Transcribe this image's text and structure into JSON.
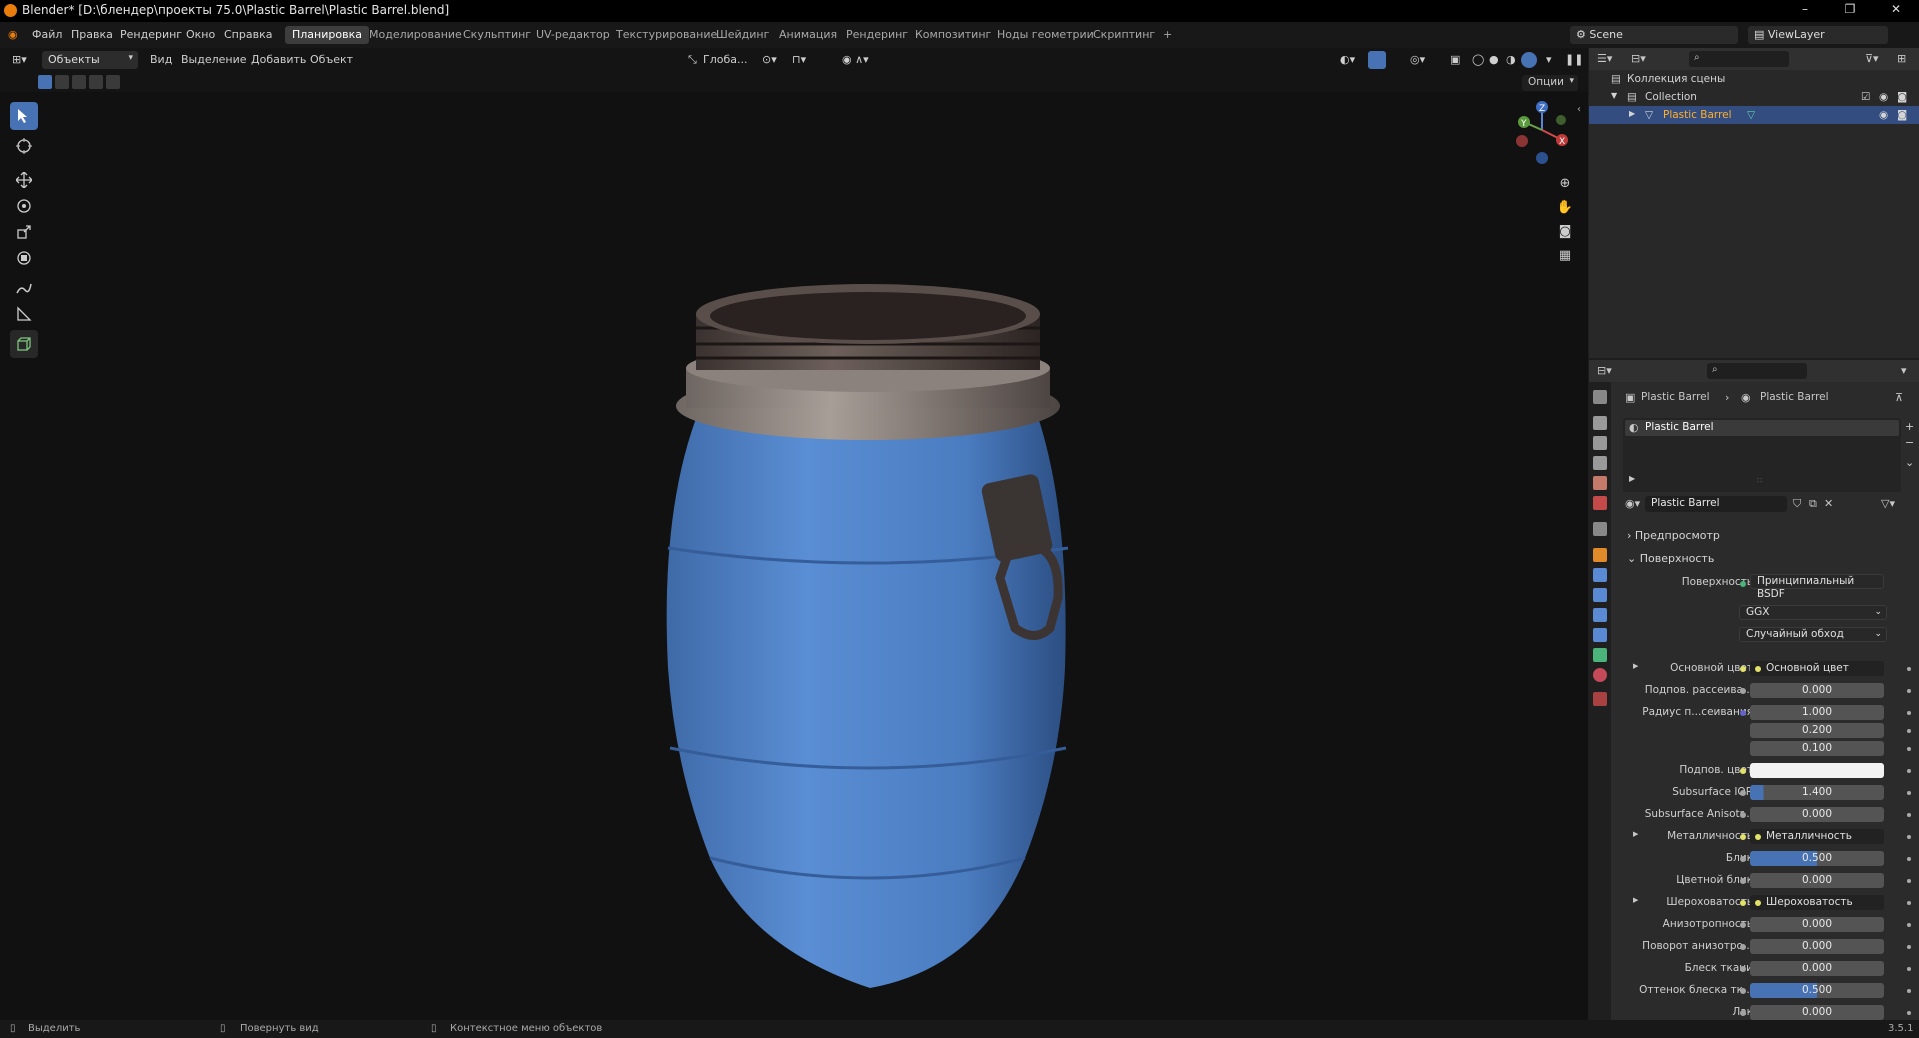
{
  "window": {
    "title": "Blender* [D:\\блендер\\проекты 75.0\\Plastic Barrel\\Plastic Barrel.blend]"
  },
  "menu": {
    "items": [
      "Файл",
      "Правка",
      "Рендеринг",
      "Окно",
      "Справка"
    ]
  },
  "workspaces": {
    "items": [
      "Планировка",
      "Моделирование",
      "Скульптинг",
      "UV-редактор",
      "Текстурирование",
      "Шейдинг",
      "Анимация",
      "Рендеринг",
      "Композитинг",
      "Ноды геометрии",
      "Скриптинг",
      "+"
    ],
    "active": "Планировка"
  },
  "scene": {
    "name": "Scene",
    "view_layer": "ViewLayer"
  },
  "viewport": {
    "mode": "Объекты",
    "menus": [
      "Вид",
      "Выделение",
      "Добавить",
      "Объект"
    ],
    "transform_orientation": "Глоба...",
    "options": "Опции",
    "gizmo": {
      "x": "X",
      "y": "Y",
      "z": "Z"
    }
  },
  "outliner": {
    "root": "Коллекция сцены",
    "collection": "Collection",
    "object": "Plastic Barrel"
  },
  "properties": {
    "breadcrumb": [
      "Plastic Barrel",
      "Plastic Barrel"
    ],
    "slot": "Plastic Barrel",
    "material_name": "Plastic Barrel",
    "sections": {
      "preview": "Предпросмотр",
      "surface": "Поверхность"
    },
    "surface_label": "Поверхность",
    "surface_value": "Принципиальный BSDF",
    "distribution": "GGX",
    "subsurface_method": "Случайный обход",
    "rows": [
      {
        "label": "Основной цвет",
        "value": "Основной цвет",
        "kind": "link"
      },
      {
        "label": "Подпов. рассеива...",
        "value": "0.000",
        "kind": "num"
      },
      {
        "label": "Радиус п...сеивания",
        "value": "1.000",
        "kind": "num"
      },
      {
        "label": "",
        "value": "0.200",
        "kind": "num"
      },
      {
        "label": "",
        "value": "0.100",
        "kind": "num"
      },
      {
        "label": "Подпов. цвет",
        "value": "",
        "kind": "color"
      },
      {
        "label": "Subsurface IOR",
        "value": "1.400",
        "kind": "num",
        "fill": 0.1
      },
      {
        "label": "Subsurface Anisotr...",
        "value": "0.000",
        "kind": "num"
      },
      {
        "label": "Металличность",
        "value": "Металличность",
        "kind": "link"
      },
      {
        "label": "Блик",
        "value": "0.500",
        "kind": "num",
        "fill": 0.5
      },
      {
        "label": "Цветной блик",
        "value": "0.000",
        "kind": "num"
      },
      {
        "label": "Шероховатость",
        "value": "Шероховатость",
        "kind": "link"
      },
      {
        "label": "Анизотропность",
        "value": "0.000",
        "kind": "num"
      },
      {
        "label": "Поворот анизотро...",
        "value": "0.000",
        "kind": "num"
      },
      {
        "label": "Блеск ткани",
        "value": "0.000",
        "kind": "num"
      },
      {
        "label": "Оттенок блеска тк...",
        "value": "0.500",
        "kind": "num",
        "fill": 0.5
      },
      {
        "label": "Лак",
        "value": "0.000",
        "kind": "num"
      }
    ]
  },
  "status": {
    "select": "Выделить",
    "rotate": "Повернуть вид",
    "context": "Контекстное меню объектов",
    "version": "3.5.1"
  },
  "colors": {
    "accent": "#4772b3",
    "barrel": "#4a7ec4",
    "selected_row": "#334d80"
  }
}
